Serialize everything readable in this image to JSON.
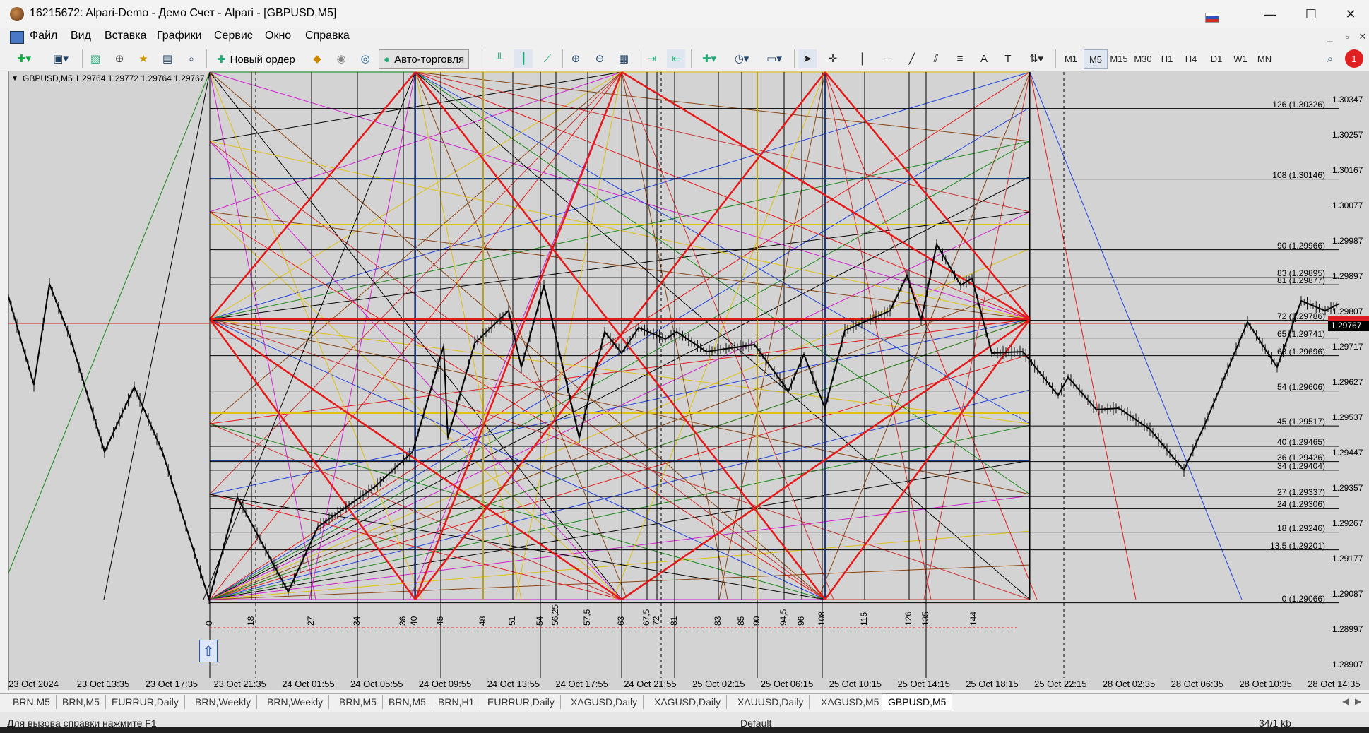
{
  "window": {
    "title": "16215672: Alpari-Demo - Демо Счет - Alpari - [GBPUSD,M5]",
    "minimize_glyph": "—",
    "maximize_glyph": "☐",
    "close_glyph": "✕"
  },
  "menu": {
    "items": [
      "Файл",
      "Вид",
      "Вставка",
      "Графики",
      "Сервис",
      "Окно",
      "Справка"
    ]
  },
  "toolbar": {
    "new_order_label": "Новый ордер",
    "autotrade_label": "Авто-торговля",
    "timeframes": [
      "M1",
      "M5",
      "M15",
      "M30",
      "H1",
      "H4",
      "D1",
      "W1",
      "MN"
    ],
    "active_timeframe": "M5",
    "notification_count": "1"
  },
  "chart": {
    "symbol_info": "GBPUSD,M5  1.29764 1.29772 1.29764 1.29767",
    "current_price": "1.29767",
    "price_axis": [
      "1.30347",
      "1.30257",
      "1.30167",
      "1.30077",
      "1.29987",
      "1.29897",
      "1.29807",
      "1.29717",
      "1.29627",
      "1.29537",
      "1.29447",
      "1.29357",
      "1.29267",
      "1.29177",
      "1.29087",
      "1.28997",
      "1.28907"
    ],
    "time_axis": [
      "23 Oct 2024",
      "23 Oct 13:35",
      "23 Oct 17:35",
      "23 Oct 21:35",
      "24 Oct 01:55",
      "24 Oct 05:55",
      "24 Oct 09:55",
      "24 Oct 13:55",
      "24 Oct 17:55",
      "24 Oct 21:55",
      "25 Oct 02:15",
      "25 Oct 06:15",
      "25 Oct 10:15",
      "25 Oct 14:15",
      "25 Oct 18:15",
      "25 Oct 22:15",
      "28 Oct 02:35",
      "28 Oct 06:35",
      "28 Oct 10:35",
      "28 Oct 14:35"
    ],
    "levels": [
      "126 (1.30326)",
      "108 (1.30146)",
      "90 (1.29966)",
      "83 (1.29895)",
      "81 (1.29877)",
      "72 (1.29786)",
      "65 (1.29741)",
      "63 (1.29696)",
      "54 (1.29606)",
      "45 (1.29517)",
      "40 (1.29465)",
      "36 (1.29426)",
      "34 (1.29404)",
      "27 (1.29337)",
      "24 (1.29306)",
      "18 (1.29246)",
      "13.5 (1.29201)",
      "0 (1.29066)"
    ],
    "time_numbers": [
      "0",
      "18",
      "27",
      "34",
      "36",
      "40",
      "45",
      "48",
      "51",
      "54",
      "56,25",
      "57,5",
      "63",
      "67,5",
      "72",
      "81",
      "83",
      "85",
      "90",
      "94,5",
      "96",
      "108",
      "115",
      "126",
      "135",
      "144"
    ],
    "colors": {
      "background": "#d3d3d3",
      "frame_red": "#e41a1a",
      "price_line": "#000000"
    }
  },
  "tabs": [
    "BRN,M5",
    "BRN,M5",
    "EURRUR,Daily",
    "BRN,Weekly",
    "BRN,Weekly",
    "BRN,M5",
    "BRN,M5",
    "BRN,H1",
    "EURRUR,Daily",
    "XAGUSD,Daily",
    "XAGUSD,Daily",
    "XAUUSD,Daily",
    "XAGUSD,M5",
    "GBPUSD,M5"
  ],
  "active_tab": "GBPUSD,M5",
  "status": {
    "help_text": "Для вызова справки нажмите F1",
    "profile": "Default",
    "traffic": "34/1 kb"
  }
}
